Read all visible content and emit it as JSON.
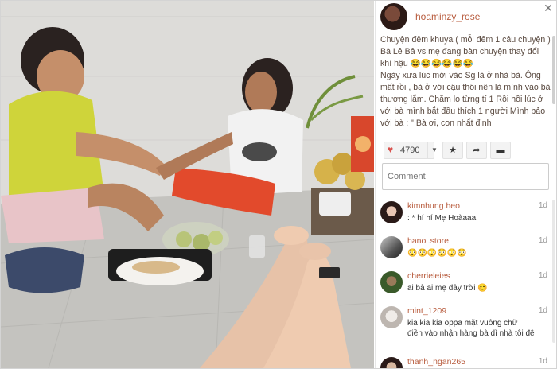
{
  "post": {
    "username": "hoaminzy_rose",
    "caption": "Chuyện đêm khuya ( mỗi đêm 1 câu chuyện ) Bà Lê Bả vs mẹ đang bàn chuyện thay đổi khí hậu 😂😂😂😂😂😂\nNgày xưa lúc mới vào Sg là ở nhà bà. Ông mất rồi , bà ở với cậu thôi nên là mình vào bà thương lắm. Chăm lo từng tí 1 Rồi hồi lúc ở với bà mình bắt đầu thích 1 người Mình bảo với bà : \" Bà ơi, con nhất định",
    "likes": "4790",
    "close_icon": "✕"
  },
  "actions": {
    "heart_icon": "♥",
    "dropdown_icon": "▼",
    "star_icon": "★",
    "share_icon": "➦",
    "comment_icon": "▬"
  },
  "comment_input": {
    "placeholder": "Comment"
  },
  "comments": [
    {
      "user": "kimnhung.heo",
      "text": ": * hí hí Mẹ Hoàaaa",
      "time": "1d"
    },
    {
      "user": "hanoi.store",
      "text": "😳😳😳😳😳😳",
      "time": "1d"
    },
    {
      "user": "cherrieleies",
      "text": "ai bả ai mẹ đây trời 😊",
      "time": "1d"
    },
    {
      "user": "mint_1209",
      "text": "kia kia kia oppa mặt vuông chữ điền vào nhận hàng bà dì nhà tôi đê",
      "time": "1d"
    },
    {
      "user": "thanh_ngan265",
      "text": "",
      "time": "1d"
    }
  ]
}
